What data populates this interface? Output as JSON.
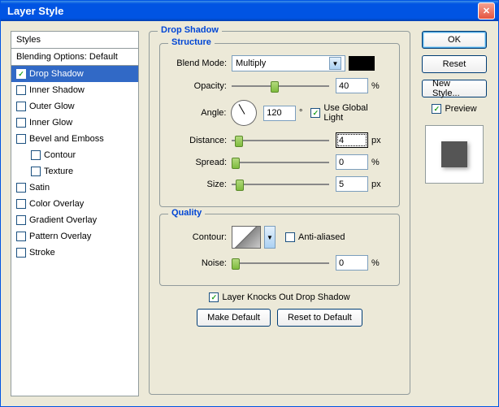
{
  "window": {
    "title": "Layer Style"
  },
  "sidebar": {
    "header": "Styles",
    "subheader": "Blending Options: Default",
    "items": [
      {
        "label": "Drop Shadow",
        "checked": true,
        "selected": true
      },
      {
        "label": "Inner Shadow",
        "checked": false
      },
      {
        "label": "Outer Glow",
        "checked": false
      },
      {
        "label": "Inner Glow",
        "checked": false
      },
      {
        "label": "Bevel and Emboss",
        "checked": false
      },
      {
        "label": "Contour",
        "checked": false,
        "sub": true
      },
      {
        "label": "Texture",
        "checked": false,
        "sub": true
      },
      {
        "label": "Satin",
        "checked": false
      },
      {
        "label": "Color Overlay",
        "checked": false
      },
      {
        "label": "Gradient Overlay",
        "checked": false
      },
      {
        "label": "Pattern Overlay",
        "checked": false
      },
      {
        "label": "Stroke",
        "checked": false
      }
    ]
  },
  "main": {
    "title": "Drop Shadow",
    "structure": {
      "legend": "Structure",
      "blend_mode_label": "Blend Mode:",
      "blend_mode_value": "Multiply",
      "color": "#000000",
      "opacity_label": "Opacity:",
      "opacity_value": "40",
      "opacity_unit": "%",
      "angle_label": "Angle:",
      "angle_value": "120",
      "angle_unit": "°",
      "global_light_label": "Use Global Light",
      "global_light_checked": true,
      "distance_label": "Distance:",
      "distance_value": "4",
      "distance_unit": "px",
      "spread_label": "Spread:",
      "spread_value": "0",
      "spread_unit": "%",
      "size_label": "Size:",
      "size_value": "5",
      "size_unit": "px"
    },
    "quality": {
      "legend": "Quality",
      "contour_label": "Contour:",
      "antialiased_label": "Anti-aliased",
      "antialiased_checked": false,
      "noise_label": "Noise:",
      "noise_value": "0",
      "noise_unit": "%"
    },
    "knockout_label": "Layer Knocks Out Drop Shadow",
    "knockout_checked": true,
    "make_default": "Make Default",
    "reset_default": "Reset to Default"
  },
  "buttons": {
    "ok": "OK",
    "reset": "Reset",
    "new_style": "New Style...",
    "preview": "Preview",
    "preview_checked": true
  }
}
